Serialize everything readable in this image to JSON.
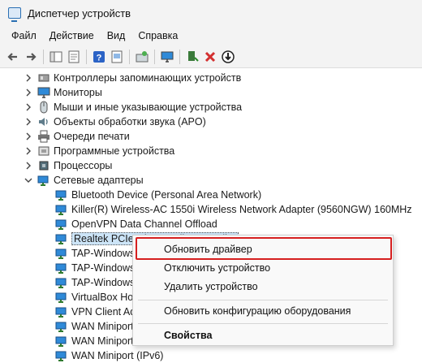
{
  "window": {
    "title": "Диспетчер устройств"
  },
  "menu": [
    "Файл",
    "Действие",
    "Вид",
    "Справка"
  ],
  "toolbar": {
    "icons": [
      "back-arrow-icon",
      "forward-arrow-icon",
      "show-hide-tree-icon",
      "properties-icon",
      "help-icon",
      "view-icon",
      "scan-hardware-icon",
      "monitor-icon",
      "update-driver-icon",
      "uninstall-icon",
      "disable-icon"
    ]
  },
  "tree": {
    "categories": [
      "Контроллеры запоминающих устройств",
      "Мониторы",
      "Мыши и иные указывающие устройства",
      "Объекты обработки звука (APO)",
      "Очереди печати",
      "Программные устройства",
      "Процессоры",
      "Сетевые адаптеры"
    ],
    "adapters": [
      "Bluetooth Device (Personal Area Network)",
      "Killer(R) Wireless-AC 1550i Wireless Network Adapter (9560NGW) 160MHz",
      "OpenVPN Data Channel Offload",
      "Realtek PCIe GbE Family Controller",
      "TAP-Windows",
      "TAP-Windows",
      "TAP-Windows",
      "VirtualBox Host",
      "VPN Client Ada",
      "WAN Miniport",
      "WAN Miniport",
      "WAN Miniport (IPv6)"
    ]
  },
  "context_menu": {
    "update_driver": "Обновить драйвер",
    "disable_device": "Отключить устройство",
    "uninstall_device": "Удалить устройство",
    "scan_hardware": "Обновить конфигурацию оборудования",
    "properties": "Свойства"
  }
}
